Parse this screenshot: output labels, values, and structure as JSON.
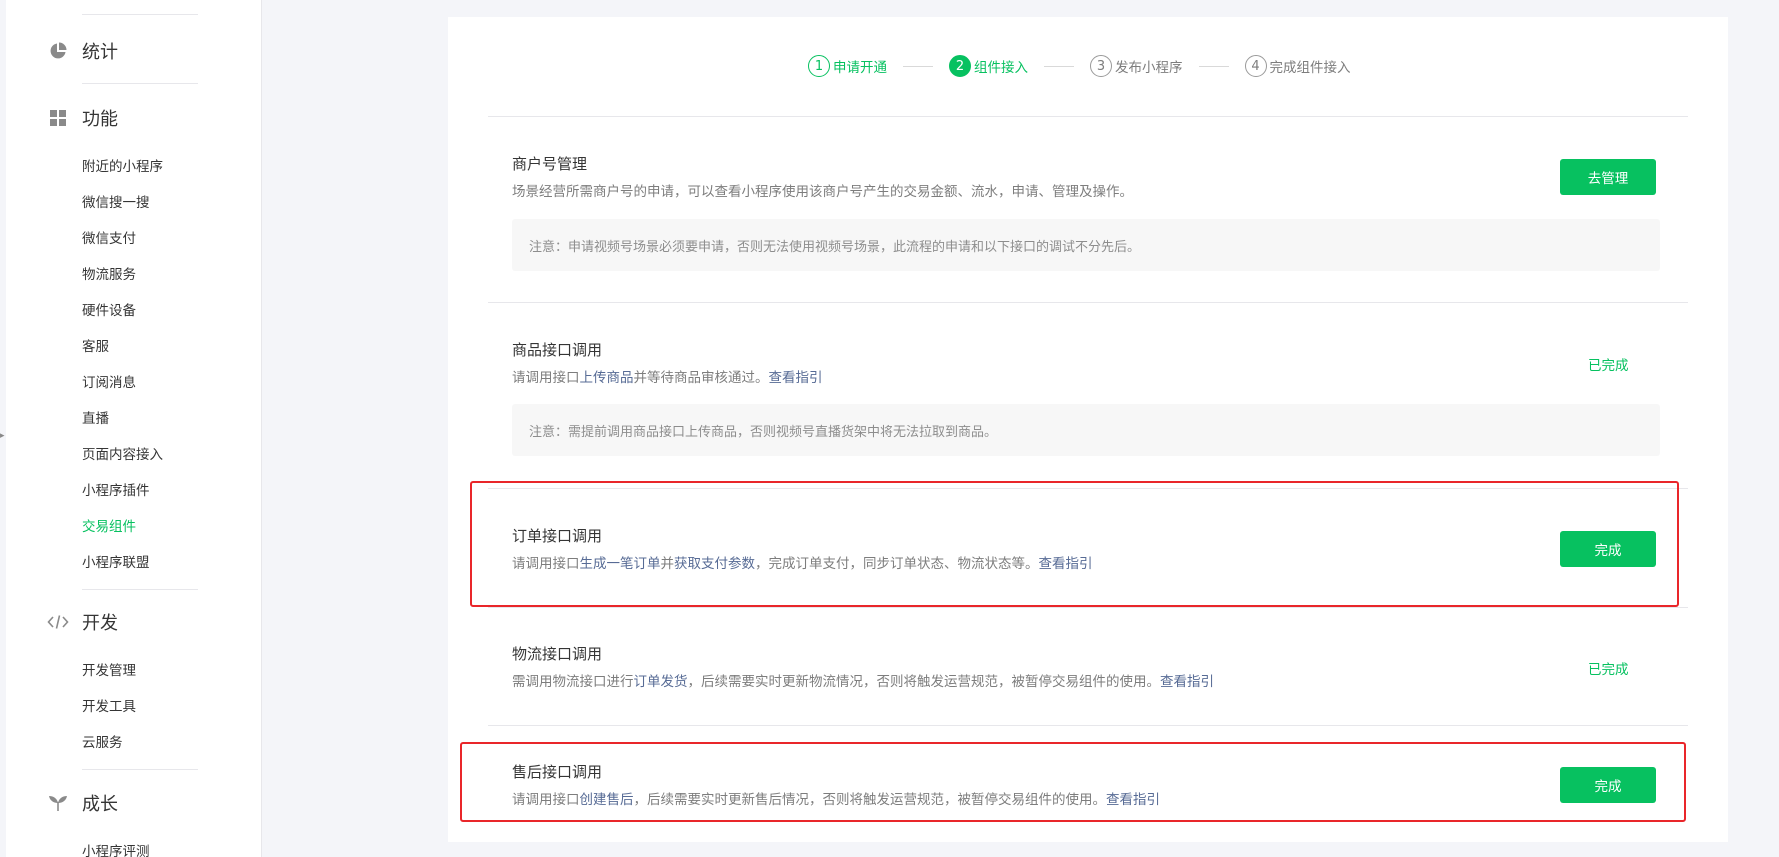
{
  "sidebar": {
    "groups": {
      "stats": {
        "label": "统计",
        "icon": "pie-chart-icon"
      },
      "features": {
        "label": "功能",
        "icon": "grid-icon"
      },
      "dev": {
        "label": "开发",
        "icon": "code-icon"
      },
      "growth": {
        "label": "成长",
        "icon": "sprout-icon"
      }
    },
    "feature_items": [
      "附近的小程序",
      "微信搜一搜",
      "微信支付",
      "物流服务",
      "硬件设备",
      "客服",
      "订阅消息",
      "直播",
      "页面内容接入",
      "小程序插件",
      "交易组件",
      "小程序联盟"
    ],
    "active_item": "交易组件",
    "dev_items": [
      "开发管理",
      "开发工具",
      "云服务"
    ],
    "growth_items": [
      "小程序评测"
    ]
  },
  "stepper": {
    "steps": [
      {
        "num": "1",
        "label": "申请开通",
        "state": "done"
      },
      {
        "num": "2",
        "label": "组件接入",
        "state": "current"
      },
      {
        "num": "3",
        "label": "发布小程序",
        "state": "todo"
      },
      {
        "num": "4",
        "label": "完成组件接入",
        "state": "todo"
      }
    ]
  },
  "sections": {
    "merchant": {
      "title": "商户号管理",
      "desc": "场景经营所需商户号的申请，可以查看小程序使用该商户号产生的交易金额、流水，申请、管理及操作。",
      "note": "注意：申请视频号场景必须要申请，否则无法使用视频号场景，此流程的申请和以下接口的调试不分先后。",
      "button": "去管理"
    },
    "product": {
      "title": "商品接口调用",
      "desc_1": "请调用接口",
      "link_1": "上传商品",
      "desc_2": "并等待商品审核通过。",
      "guide": "查看指引",
      "note": "注意：需提前调用商品接口上传商品，否则视频号直播货架中将无法拉取到商品。",
      "status": "已完成"
    },
    "order": {
      "title": "订单接口调用",
      "desc_1": "请调用接口",
      "link_1": "生成一笔订单",
      "desc_2": "并",
      "link_2": "获取支付参数",
      "desc_3": "，完成订单支付，同步订单状态、物流状态等。",
      "guide": "查看指引",
      "button": "完成"
    },
    "logistics": {
      "title": "物流接口调用",
      "desc_1": "需调用物流接口进行",
      "link_1": "订单发货",
      "desc_2": "，后续需要实时更新物流情况，否则将触发运营规范，被暂停交易组件的使用。",
      "guide": "查看指引",
      "status": "已完成"
    },
    "aftersale": {
      "title": "售后接口调用",
      "desc_1": "请调用接口",
      "link_1": "创建售后",
      "desc_2": "，后续需要实时更新售后情况，否则将触发运营规范，被暂停交易组件的使用。",
      "guide": "查看指引",
      "button": "完成"
    }
  },
  "colors": {
    "accent": "#07c160",
    "link": "#576b95",
    "highlight": "#e9262a"
  }
}
